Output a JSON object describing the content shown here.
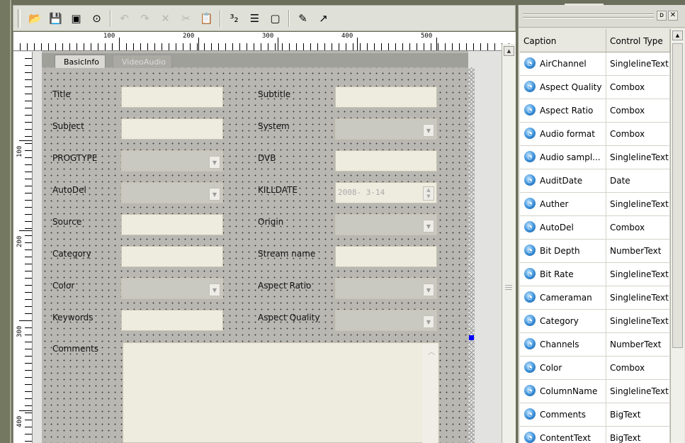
{
  "toolbar": {
    "buttons": [
      {
        "name": "open-icon",
        "glyph": "📂"
      },
      {
        "name": "save-icon",
        "glyph": "💾"
      },
      {
        "name": "save-as-icon",
        "glyph": "▣"
      },
      {
        "name": "preview-icon",
        "glyph": "⊙"
      },
      {
        "name": "undo-icon",
        "glyph": "↶"
      },
      {
        "name": "redo-icon",
        "glyph": "↷"
      },
      {
        "name": "delete-icon",
        "glyph": "✕"
      },
      {
        "name": "cut-icon",
        "glyph": "✂"
      },
      {
        "name": "paste-icon",
        "glyph": "📋"
      },
      {
        "name": "tab-order-icon",
        "glyph": "³₂"
      },
      {
        "name": "align-icon",
        "glyph": "☰"
      },
      {
        "name": "layout-icon",
        "glyph": "▢"
      },
      {
        "name": "properties-icon",
        "glyph": "✎"
      },
      {
        "name": "export-icon",
        "glyph": "↗"
      }
    ]
  },
  "ruler": {
    "top_labels": [
      "100",
      "200",
      "300",
      "400",
      "500"
    ],
    "left_labels": [
      "100",
      "200",
      "300",
      "400"
    ]
  },
  "form": {
    "tabs": [
      {
        "label": "BasicInfo",
        "active": true
      },
      {
        "label": "VideoAudio",
        "active": false
      }
    ],
    "left_fields": [
      {
        "label": "Title",
        "type": "text"
      },
      {
        "label": "Subject",
        "type": "text"
      },
      {
        "label": "PROGTYPE",
        "type": "combo"
      },
      {
        "label": "AutoDel",
        "type": "combo"
      },
      {
        "label": "Source",
        "type": "text"
      },
      {
        "label": "Category",
        "type": "text"
      },
      {
        "label": "Color",
        "type": "combo"
      },
      {
        "label": "Keywords",
        "type": "text"
      }
    ],
    "right_fields": [
      {
        "label": "Subtitle",
        "type": "text"
      },
      {
        "label": "System",
        "type": "combo"
      },
      {
        "label": "DVB",
        "type": "text"
      },
      {
        "label": "KILLDATE",
        "type": "date",
        "value": "2008- 3-14"
      },
      {
        "label": "Origin",
        "type": "combo"
      },
      {
        "label": "Stream name",
        "type": "text"
      },
      {
        "label": "Aspect Ratio",
        "type": "combo"
      },
      {
        "label": "Aspect Quality",
        "type": "combo"
      }
    ],
    "comments_label": "Comments"
  },
  "panel": {
    "columns": [
      "Caption",
      "Control Type"
    ],
    "rows": [
      {
        "caption": "AirChannel",
        "type": "SinglelineText"
      },
      {
        "caption": "Aspect Quality",
        "type": "Combox"
      },
      {
        "caption": "Aspect Ratio",
        "type": "Combox"
      },
      {
        "caption": "Audio format",
        "type": "Combox"
      },
      {
        "caption": "Audio sampl...",
        "type": "SinglelineText"
      },
      {
        "caption": "AuditDate",
        "type": "Date"
      },
      {
        "caption": "Auther",
        "type": "SinglelineText"
      },
      {
        "caption": "AutoDel",
        "type": "Combox"
      },
      {
        "caption": "Bit Depth",
        "type": "NumberText"
      },
      {
        "caption": "Bit Rate",
        "type": "SinglelineText"
      },
      {
        "caption": "Cameraman",
        "type": "SinglelineText"
      },
      {
        "caption": "Category",
        "type": "SinglelineText"
      },
      {
        "caption": "Channels",
        "type": "NumberText"
      },
      {
        "caption": "Color",
        "type": "Combox"
      },
      {
        "caption": "ColumnName",
        "type": "SinglelineText"
      },
      {
        "caption": "Comments",
        "type": "BigText"
      },
      {
        "caption": "ContentText",
        "type": "BigText"
      }
    ]
  }
}
